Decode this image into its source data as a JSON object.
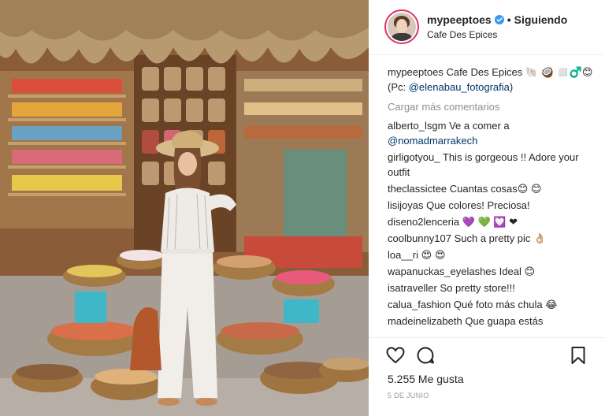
{
  "post": {
    "username": "mypeeptoes",
    "separator": "•",
    "follow_status": "Siguiendo",
    "location": "Cafe Des Epices"
  },
  "caption": {
    "username": "mypeeptoes",
    "text": "Cafe Des Epices 🐚 🥥 ◻️♂️😊",
    "credit_prefix": "(Pc: ",
    "credit_link": "@elenabau_fotografia",
    "credit_suffix": ")"
  },
  "load_more": "Cargar más comentarios",
  "comments": [
    {
      "user": "alberto_lsgm",
      "text": "Ve a comer a",
      "link": "@nomadmarrakech"
    },
    {
      "user": "girligotyou_",
      "text": "This is gorgeous !! Adore your outfit"
    },
    {
      "user": "theclassictee",
      "text": "Cuantas cosas😊 😊"
    },
    {
      "user": "lisijoyas",
      "text": "Que colores! Preciosa!"
    },
    {
      "user": "diseno2lenceria",
      "text": "💜 💚 💟 ❤"
    },
    {
      "user": "coolbunny107",
      "text": "Such a pretty pic 👌🏼"
    },
    {
      "user": "loa__ri",
      "text": "😍 😍"
    },
    {
      "user": "wapanuckas_eyelashes",
      "text": "Ideal 😊"
    },
    {
      "user": "isatraveller",
      "text": "So pretty store!!!"
    },
    {
      "user": "calua_fashion",
      "text": "Qué foto más chula 😂"
    },
    {
      "user": "madeinelizabeth",
      "text": "Que guapa estás"
    }
  ],
  "likes": "5.255 Me gusta",
  "date": "5 DE JUNIO",
  "colors": {
    "link": "#003569",
    "muted": "#8e8e8e",
    "avatar_ring": "#e1306c",
    "verified": "#3897f0"
  },
  "icons": [
    "verified-badge-icon",
    "heart-icon",
    "comment-icon",
    "bookmark-icon"
  ]
}
